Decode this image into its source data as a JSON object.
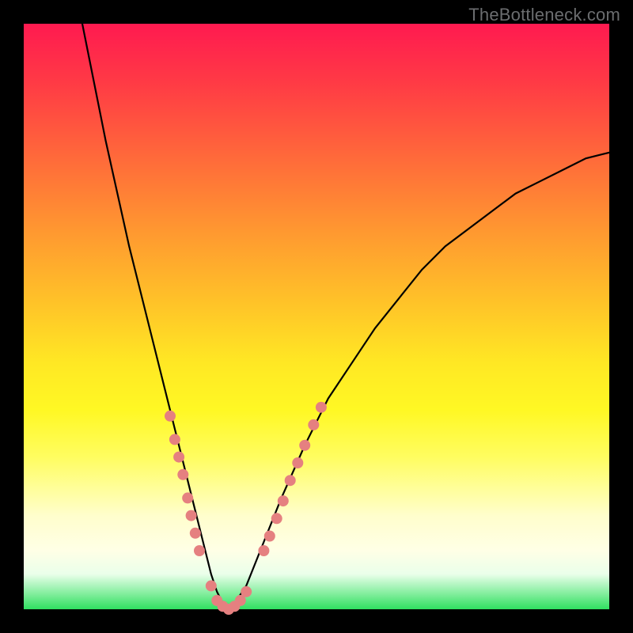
{
  "watermark": "TheBottleneck.com",
  "chart_data": {
    "type": "line",
    "title": "",
    "xlabel": "",
    "ylabel": "",
    "xlim": [
      0,
      100
    ],
    "ylim": [
      0,
      100
    ],
    "series": [
      {
        "name": "bottleneck-curve",
        "x": [
          10,
          12,
          14,
          16,
          18,
          20,
          22,
          24,
          26,
          27,
          28,
          29,
          30,
          31,
          32,
          33,
          34,
          35,
          36,
          38,
          40,
          42,
          44,
          48,
          52,
          56,
          60,
          64,
          68,
          72,
          76,
          80,
          84,
          88,
          92,
          96,
          100
        ],
        "values": [
          100,
          90,
          80,
          71,
          62,
          54,
          46,
          38,
          30,
          26,
          22,
          18,
          14,
          10,
          6,
          3,
          1,
          0,
          1,
          4,
          9,
          14,
          19,
          28,
          36,
          42,
          48,
          53,
          58,
          62,
          65,
          68,
          71,
          73,
          75,
          77,
          78
        ]
      }
    ],
    "markers": {
      "name": "highlight-points",
      "color": "#e58080",
      "radius": 7,
      "points": [
        {
          "x": 25.0,
          "y": 33
        },
        {
          "x": 25.8,
          "y": 29
        },
        {
          "x": 26.5,
          "y": 26
        },
        {
          "x": 27.2,
          "y": 23
        },
        {
          "x": 28.0,
          "y": 19
        },
        {
          "x": 28.6,
          "y": 16
        },
        {
          "x": 29.3,
          "y": 13
        },
        {
          "x": 30.0,
          "y": 10
        },
        {
          "x": 32.0,
          "y": 4
        },
        {
          "x": 33.0,
          "y": 1.5
        },
        {
          "x": 34.0,
          "y": 0.5
        },
        {
          "x": 35.0,
          "y": 0
        },
        {
          "x": 36.0,
          "y": 0.5
        },
        {
          "x": 37.0,
          "y": 1.5
        },
        {
          "x": 38.0,
          "y": 3
        },
        {
          "x": 41.0,
          "y": 10
        },
        {
          "x": 42.0,
          "y": 12.5
        },
        {
          "x": 43.2,
          "y": 15.5
        },
        {
          "x": 44.3,
          "y": 18.5
        },
        {
          "x": 45.5,
          "y": 22
        },
        {
          "x": 46.8,
          "y": 25
        },
        {
          "x": 48.0,
          "y": 28
        },
        {
          "x": 49.5,
          "y": 31.5
        },
        {
          "x": 50.8,
          "y": 34.5
        }
      ]
    }
  }
}
